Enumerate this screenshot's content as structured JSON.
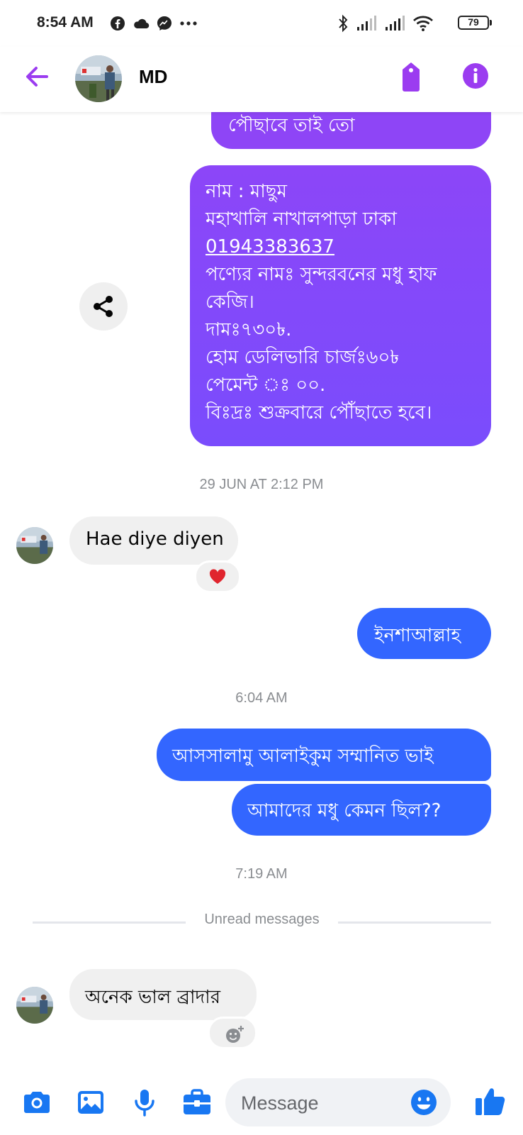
{
  "status_bar": {
    "time": "8:54 AM",
    "left_icons": [
      "facebook-icon",
      "cloud-icon",
      "messenger-icon",
      "more-dots-icon"
    ],
    "right_icons": [
      "bluetooth-icon",
      "signal-icon",
      "signal-icon",
      "wifi-icon",
      "battery-icon"
    ],
    "battery": "79"
  },
  "header": {
    "contact_name": "MD",
    "accent_color": "#9b3cf0"
  },
  "messages": {
    "top_fragment": "পৌছাবে তাই তো",
    "order": {
      "line1": "নাম : মাছুম",
      "line2": "মহাখালি নাখালপাড়া ঢাকা",
      "phone": "01943383637",
      "line4": "পণ্যের নামঃ সুন্দরবনের মধু হাফ",
      "line5": "কেজি।",
      "line6": "দামঃ৭৩০৳.",
      "line7": "হোম ডেলিভারি চার্জঃ৬০৳",
      "line8": "পেমেন্ট ঃ ০০.",
      "line9": "বিঃদ্রঃ শুক্রবারে পৌঁছাতে হবে।"
    },
    "ts1": "29 JUN AT 2:12 PM",
    "in1": "Hae diye diyen",
    "in1_reaction": "❤️",
    "out1": "ইনশাআল্লাহ",
    "ts2": "6:04 AM",
    "out2": "আসসালামু আলাইকুম সম্মানিত ভাই",
    "out3": "আমাদের মধু কেমন ছিল??",
    "ts3": "7:19 AM",
    "unread_label": "Unread messages",
    "in2": "অনেক ভাল ব্রাদার"
  },
  "composer": {
    "placeholder": "Message",
    "accent_color": "#1877f2"
  },
  "colors": {
    "outgoing_purple": "#8c46f8",
    "outgoing_blue": "#3366ff",
    "incoming_gray": "#f0f0f0"
  }
}
